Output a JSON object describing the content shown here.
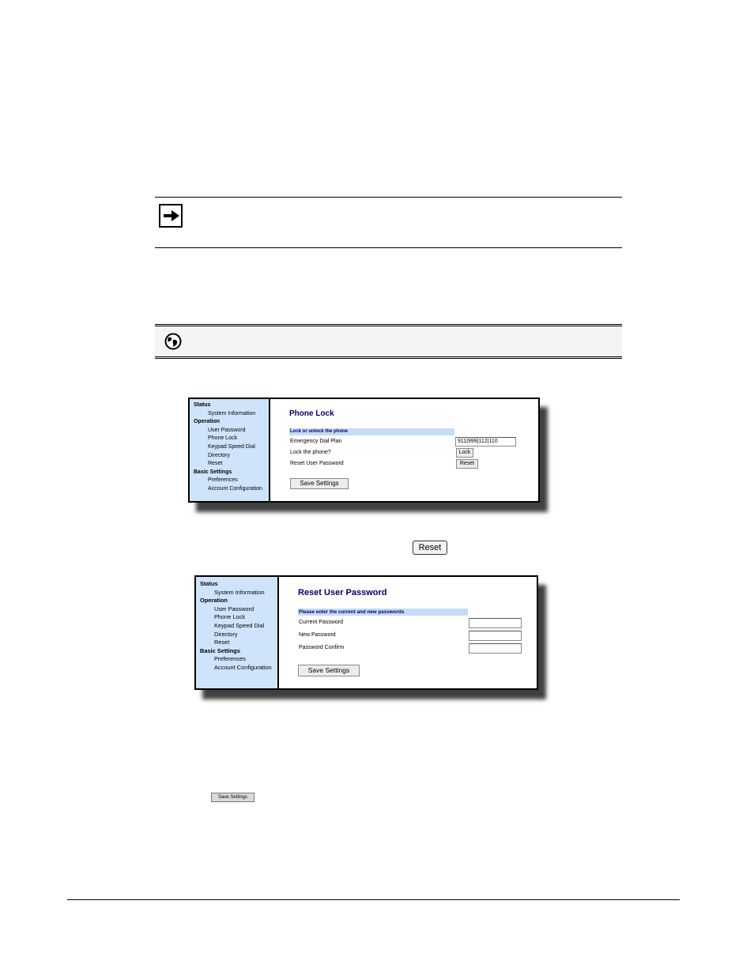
{
  "phone_lock_screen": {
    "nav": [
      {
        "label": "Status",
        "type": "section"
      },
      {
        "label": "System Information",
        "type": "item"
      },
      {
        "label": "Operation",
        "type": "section"
      },
      {
        "label": "User Password",
        "type": "item"
      },
      {
        "label": "Phone Lock",
        "type": "item"
      },
      {
        "label": "Keypad Speed Dial",
        "type": "item"
      },
      {
        "label": "Directory",
        "type": "item"
      },
      {
        "label": "Reset",
        "type": "item"
      },
      {
        "label": "Basic Settings",
        "type": "section"
      },
      {
        "label": "Preferences",
        "type": "item"
      },
      {
        "label": "Account Configuration",
        "type": "item"
      }
    ],
    "title": "Phone Lock",
    "section_header": "Lock or unlock the phone",
    "emergency_label": "Emergency Dial Plan",
    "emergency_value": "911|999|112|110",
    "lock_label": "Lock the phone?",
    "lock_button": "Lock",
    "reset_label": "Reset User Password",
    "reset_button": "Reset",
    "save_button": "Save Settings"
  },
  "inline_reset_button": "Reset",
  "reset_password_screen": {
    "nav": [
      {
        "label": "Status",
        "type": "section"
      },
      {
        "label": "System Information",
        "type": "item"
      },
      {
        "label": "Operation",
        "type": "section"
      },
      {
        "label": "User Password",
        "type": "item"
      },
      {
        "label": "Phone Lock",
        "type": "item"
      },
      {
        "label": "Keypad Speed Dial",
        "type": "item"
      },
      {
        "label": "Directory",
        "type": "item"
      },
      {
        "label": "Reset",
        "type": "item"
      },
      {
        "label": "Basic Settings",
        "type": "section"
      },
      {
        "label": "Preferences",
        "type": "item"
      },
      {
        "label": "Account Configuration",
        "type": "item"
      }
    ],
    "title": "Reset User Password",
    "section_header": "Please enter the current and new passwords",
    "current_label": "Current Password",
    "new_label": "New Password",
    "confirm_label": "Password Confirm",
    "current_value": "",
    "new_value": "",
    "confirm_value": "",
    "save_button": "Save Settings"
  },
  "inline_save_button": "Save Settings",
  "icons": {
    "note": "right-arrow-icon",
    "web_ui": "globe-icon"
  }
}
